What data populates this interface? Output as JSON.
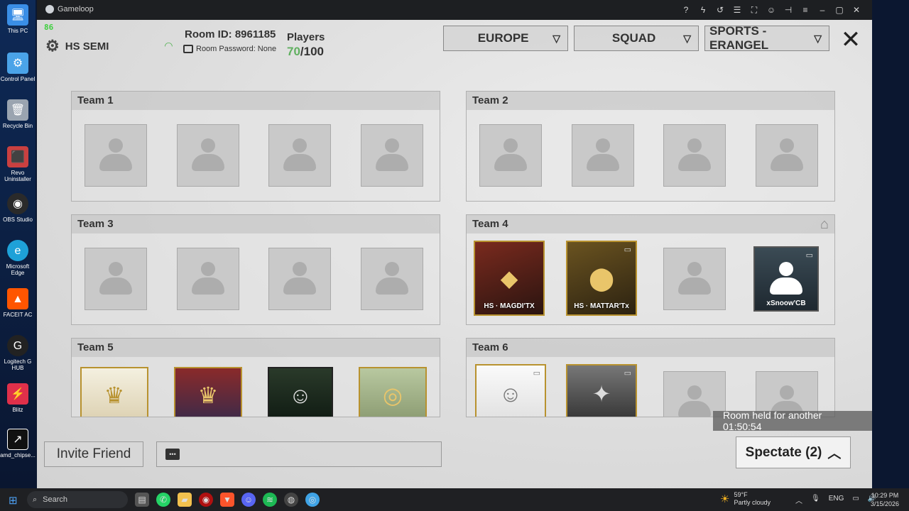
{
  "desktop": {
    "icons": [
      {
        "label": "This PC",
        "icon": "monitor-icon",
        "color": "#3a8ee6"
      },
      {
        "label": "Control Panel",
        "icon": "control-panel-icon",
        "color": "#4aa3e8"
      },
      {
        "label": "Recycle Bin",
        "icon": "recycle-bin-icon",
        "color": "#9aa4b0"
      },
      {
        "label": "Revo Uninstaller",
        "icon": "revo-icon",
        "color": "#c94040"
      },
      {
        "label": "OBS Studio",
        "icon": "obs-icon",
        "color": "#2a2a2a"
      },
      {
        "label": "Microsoft Edge",
        "icon": "edge-icon",
        "color": "#1ea1d8"
      },
      {
        "label": "FACEIT AC",
        "icon": "faceit-icon",
        "color": "#ff5500"
      },
      {
        "label": "Logitech G HUB",
        "icon": "logitech-icon",
        "color": "#222"
      },
      {
        "label": "Blitz",
        "icon": "blitz-icon",
        "color": "#e0304a"
      },
      {
        "label": "amd_chipse...",
        "icon": "amd-icon",
        "color": "#111"
      }
    ]
  },
  "window": {
    "app_name": "Gameloop"
  },
  "game": {
    "fps": "86",
    "host": "HS SEMI",
    "room_id": "Room ID: 8961185",
    "room_password": "Room Password: None",
    "players_label": "Players",
    "players_current": "70",
    "players_max": "/100",
    "region": "EUROPE",
    "mode": "SQUAD",
    "map": "SPORTS - ERANGEL",
    "teams": [
      {
        "name": "Team 1",
        "slots": [
          {
            "player": ""
          },
          {
            "player": ""
          },
          {
            "player": ""
          },
          {
            "player": ""
          }
        ]
      },
      {
        "name": "Team 2",
        "slots": [
          {
            "player": ""
          },
          {
            "player": ""
          },
          {
            "player": ""
          },
          {
            "player": ""
          }
        ]
      },
      {
        "name": "Team 3",
        "slots": [
          {
            "player": ""
          },
          {
            "player": ""
          },
          {
            "player": ""
          },
          {
            "player": ""
          }
        ]
      },
      {
        "name": "Team 4",
        "slots": [
          {
            "player": "HS · MAGDI'TX"
          },
          {
            "player": "HS · MATTAR'Tx"
          },
          {
            "player": ""
          },
          {
            "player": "xSnoow'CB"
          }
        ]
      },
      {
        "name": "Team 5",
        "slots": [
          {
            "player": ""
          },
          {
            "player": ""
          },
          {
            "player": ""
          },
          {
            "player": ""
          }
        ]
      },
      {
        "name": "Team 6",
        "slots": [
          {
            "player": ""
          },
          {
            "player": ""
          },
          {
            "player": ""
          },
          {
            "player": ""
          }
        ]
      }
    ],
    "invite_label": "Invite Friend",
    "room_held": "Room held for another 01:50:54",
    "spectate_label": "Spectate (2)"
  },
  "taskbar": {
    "search_placeholder": "Search",
    "weather_temp": "59°F",
    "weather_desc": "Partly cloudy",
    "lang": "ENG",
    "time": "10:29 PM",
    "date": "3/15/2026"
  }
}
